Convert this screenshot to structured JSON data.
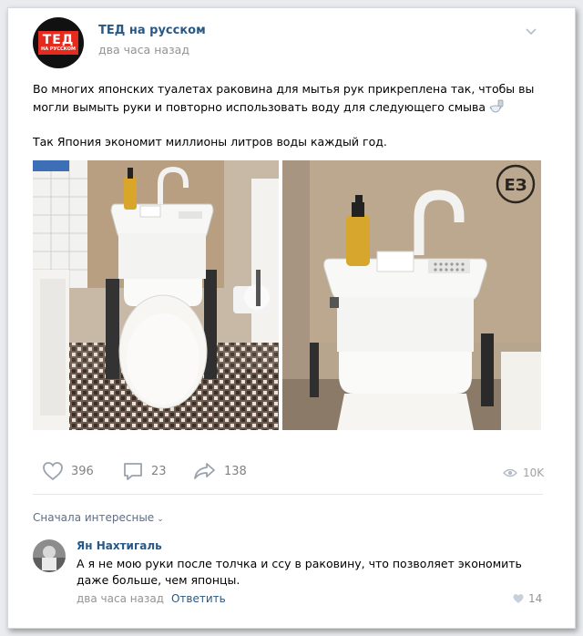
{
  "post": {
    "author": "ТЕД на русском",
    "time": "два часа назад",
    "avatar_logo_main": "ТЕД",
    "avatar_logo_sub": "НА РУССКОМ",
    "text_p1": "Во многих японских туалетах раковина для мытья рук прикреплена так, чтобы вы могли вымыть руки и повторно использовать воду для следующего смыва",
    "text_p2": "Так Япония экономит миллионы литров воды каждый год.",
    "watermark": "ЕЗ"
  },
  "actions": {
    "likes": "396",
    "comments": "23",
    "shares": "138",
    "views": "10K"
  },
  "comments": {
    "sort_label": "Сначала интересные",
    "items": [
      {
        "author": "Ян Нахтигаль",
        "text": "А я не мою руки после толчка и ссу в раковину, что позволяет экономить даже больше, чем японцы.",
        "time": "два часа назад",
        "reply_label": "Ответить",
        "likes": "14"
      }
    ]
  },
  "colors": {
    "link_blue": "#2a5885",
    "meta_gray": "#939393",
    "logo_red": "#e62b1e"
  },
  "icons": [
    "chevron-down-icon",
    "toilet-emoji-icon",
    "heart-icon",
    "comment-icon",
    "share-icon",
    "eye-icon",
    "chevron-down-icon",
    "heart-icon"
  ]
}
